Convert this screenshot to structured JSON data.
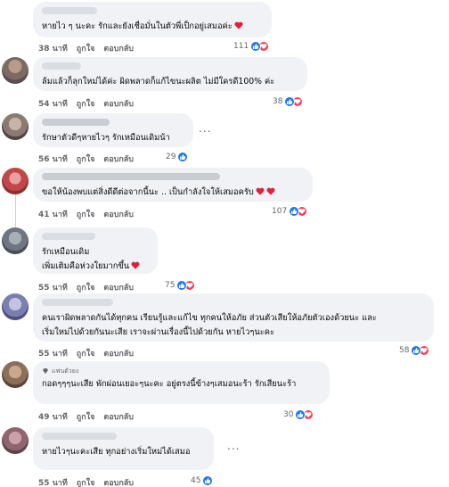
{
  "comments": [
    {
      "text": "หายไว ๆ นะคะ รักและยังเชื่อมั่นในตัวพี่เป็กอยู่เสมอค่ะ",
      "time": "38 นาที",
      "like": "ถูกใจ",
      "reply": "ตอบกลับ",
      "count": "111"
    },
    {
      "text": "ล้มแล้วก็ลุกใหม่ได้ค่ะ ผิดพลาดก็แก้ไขนะผลิต ไม่มีใครดี100% ค่ะ",
      "time": "54 นาที",
      "like": "ถูกใจ",
      "reply": "ตอบกลับ",
      "count": "38"
    },
    {
      "text": "รักษาตัวดีๆหายไวๆ รักเหมือนเดิมน้า",
      "time": "56 นาที",
      "like": "ถูกใจ",
      "reply": "ตอบกลับ",
      "count": "29"
    },
    {
      "text": "ขอให้น้องพบแต่สิ่งดีดีต่อจากนี้นะ .. เป็นกำลังใจให้เสมอครับ",
      "time": "41 นาที",
      "like": "ถูกใจ",
      "reply": "ตอบกลับ",
      "count": "107"
    },
    {
      "line1": "รักเหมือนเดิม",
      "line2": "เพิ่มเติมคือห่วงใยมากขึ้น",
      "time": "55 นาที",
      "like": "ถูกใจ",
      "reply": "ตอบกลับ",
      "count": "75"
    },
    {
      "line1": "คนเราผิดพลาดกันได้ทุกคน เรียนรู้และแก้ไข ทุกคนให้อภัย ส่วนตัวเสียให้อภัยตัวเองด้วยนะ และ",
      "line2": "เริ่มใหม่ไปด้วยกันนะเสีย เราจะผ่านเรื่องนี้ไปด้วยกัน หายไวๆนะคะ",
      "time": "55 นาที",
      "like": "ถูกใจ",
      "reply": "ตอบกลับ",
      "count": "58"
    },
    {
      "badge": "แฟนตัวยง",
      "text": "กอดๆๆๆนะเสีย พักผ่อนเยอะๆนะคะ อยู่ตรงนี้ข้างๆเสมอนะร้า รักเสียนะร้า",
      "time": "49 นาที",
      "like": "ถูกใจ",
      "reply": "ตอบกลับ",
      "count": "30"
    },
    {
      "text": "หายไวๆนะคะเสีย ทุกอย่างเริ่มใหม่ได้เสมอ",
      "time": "55 นาที",
      "like": "ถูกใจ",
      "reply": "ตอบกลับ",
      "count": "45"
    }
  ],
  "more_glyph": "...",
  "colors": {
    "like": "#1877f2",
    "love": "#f33e58",
    "bubble": "#f0f2f5",
    "meta": "#65676b"
  },
  "icons": {
    "like": "thumbs-up-icon",
    "love": "heart-icon",
    "badge": "diamond-icon",
    "more": "more-options-icon"
  }
}
